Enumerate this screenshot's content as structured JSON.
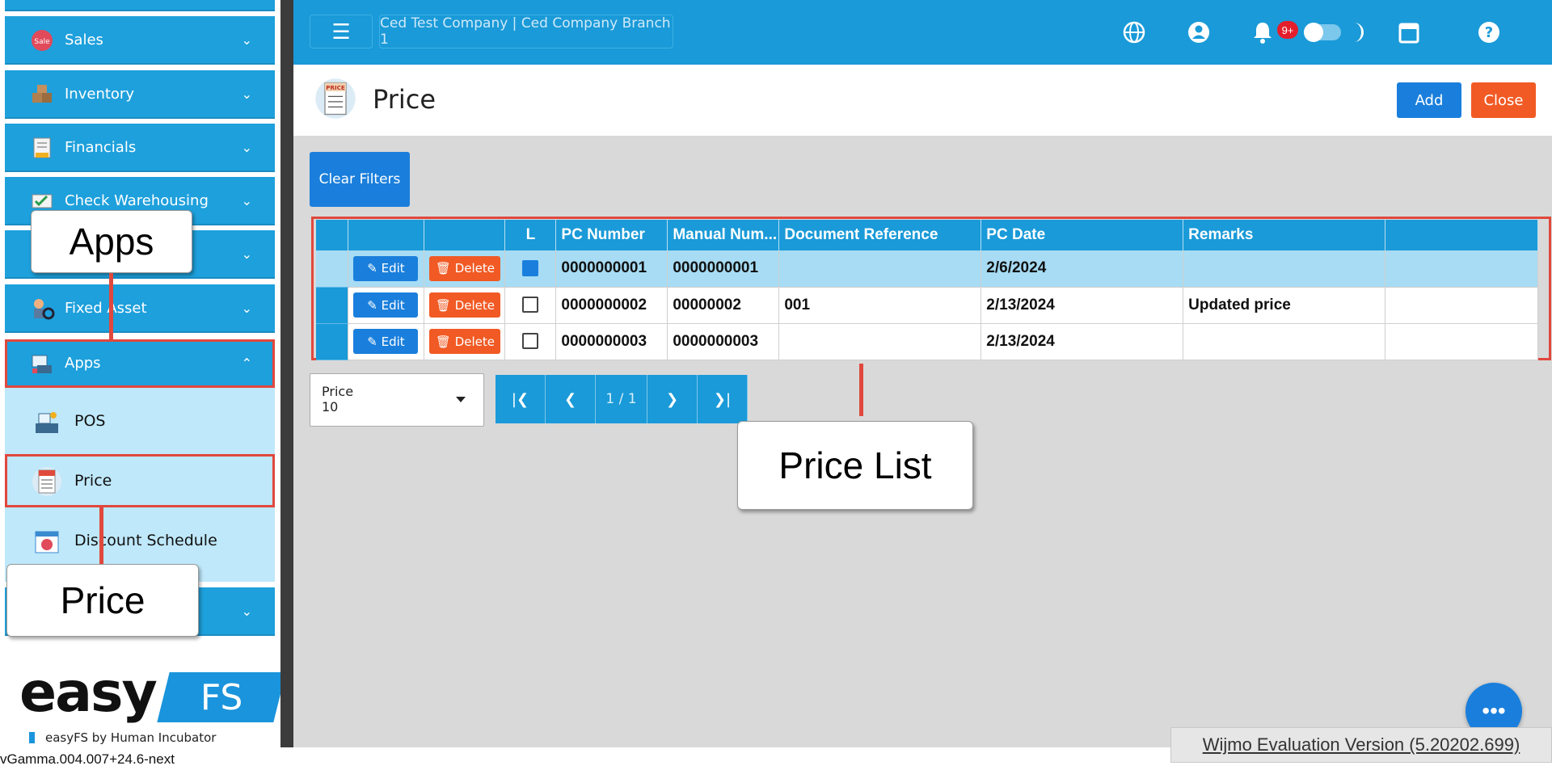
{
  "sidebar": {
    "items": [
      {
        "label": "Sales",
        "icon": "sale-tag-icon"
      },
      {
        "label": "Inventory",
        "icon": "boxes-icon"
      },
      {
        "label": "Financials",
        "icon": "ledger-icon"
      },
      {
        "label": "Check Warehousing",
        "icon": "check-icon"
      },
      {
        "label": "",
        "icon": "folder-icon"
      },
      {
        "label": "Fixed Asset",
        "icon": "asset-gear-icon"
      },
      {
        "label": "Apps",
        "icon": "apps-icon"
      }
    ],
    "sub_items": [
      {
        "label": "POS",
        "icon": "pos-register-icon"
      },
      {
        "label": "Price",
        "icon": "price-list-icon"
      },
      {
        "label": "Discount Schedule",
        "icon": "discount-calendar-icon"
      }
    ]
  },
  "logo": {
    "easy": "easy",
    "fs": "FS",
    "tagline": "easyFS by Human Incubator"
  },
  "version": "vGamma.004.007+24.6-next",
  "topbar": {
    "company": "Ced Test Company | Ced Company Branch 1",
    "notification_badge": "9+"
  },
  "page": {
    "title": "Price",
    "add_label": "Add",
    "close_label": "Close",
    "clear_filters_label": "Clear Filters"
  },
  "grid": {
    "columns": [
      "",
      "",
      "",
      "L",
      "PC Number",
      "Manual Num...",
      "Document Reference",
      "PC Date",
      "Remarks",
      ""
    ],
    "edit_label": "Edit",
    "delete_label": "Delete",
    "rows": [
      {
        "locked": true,
        "pc_number": "0000000001",
        "manual_number": "0000000001",
        "document_reference": "",
        "pc_date": "2/6/2024",
        "remarks": ""
      },
      {
        "locked": false,
        "pc_number": "0000000002",
        "manual_number": "00000002",
        "document_reference": "001",
        "pc_date": "2/13/2024",
        "remarks": "Updated price"
      },
      {
        "locked": false,
        "pc_number": "0000000003",
        "manual_number": "0000000003",
        "document_reference": "",
        "pc_date": "2/13/2024",
        "remarks": ""
      }
    ]
  },
  "pager": {
    "select_label": "Price",
    "select_value": "10",
    "page_text": "1 / 1"
  },
  "wijmo_notice": "Wijmo Evaluation Version (5.20202.699)",
  "callouts": {
    "apps": "Apps",
    "price": "Price",
    "price_list": "Price List"
  },
  "colors": {
    "primary": "#1a9ad8",
    "button_blue": "#1a7fdc",
    "button_orange": "#f15a24",
    "highlight_red": "#e0483d",
    "submenu_bg": "#bfe8fa"
  }
}
